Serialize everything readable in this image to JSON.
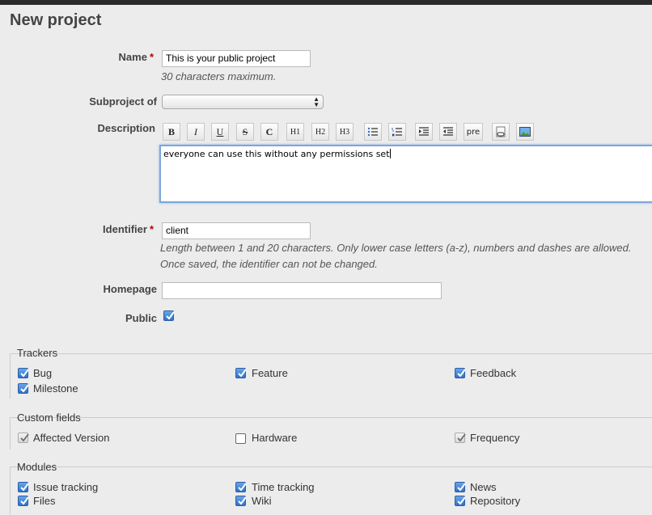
{
  "page": {
    "title": "New project"
  },
  "form": {
    "name": {
      "label": "Name",
      "required_mark": "*",
      "value": "This is your public project",
      "hint": "30 characters maximum."
    },
    "subproject": {
      "label": "Subproject of",
      "value": ""
    },
    "description": {
      "label": "Description",
      "toolbar": [
        "B",
        "I",
        "U",
        "S",
        "C",
        "H1",
        "H2",
        "H3",
        "ul",
        "ol",
        "indent",
        "outdent",
        "pre",
        "link",
        "image"
      ],
      "pre_label": "pre",
      "value": "everyone can use this without any permissions set"
    },
    "identifier": {
      "label": "Identifier",
      "required_mark": "*",
      "value": "client",
      "hint1": "Length between 1 and 20 characters. Only lower case letters (a-z), numbers and dashes are allowed.",
      "hint2": "Once saved, the identifier can not be changed."
    },
    "homepage": {
      "label": "Homepage",
      "value": ""
    },
    "public": {
      "label": "Public",
      "checked": true
    }
  },
  "trackers": {
    "legend": "Trackers",
    "items": [
      {
        "label": "Bug",
        "checked": true
      },
      {
        "label": "Feature",
        "checked": true
      },
      {
        "label": "Feedback",
        "checked": true
      },
      {
        "label": "Milestone",
        "checked": true
      }
    ]
  },
  "custom_fields": {
    "legend": "Custom fields",
    "items": [
      {
        "label": "Affected Version",
        "checked": true,
        "disabled": true
      },
      {
        "label": "Hardware",
        "checked": false,
        "disabled": false
      },
      {
        "label": "Frequency",
        "checked": true,
        "disabled": true
      }
    ]
  },
  "modules": {
    "legend": "Modules",
    "items": [
      {
        "label": "Issue tracking",
        "checked": true
      },
      {
        "label": "Time tracking",
        "checked": true
      },
      {
        "label": "News",
        "checked": true
      },
      {
        "label": "Files",
        "checked": true
      },
      {
        "label": "Wiki",
        "checked": true
      },
      {
        "label": "Repository",
        "checked": true
      }
    ]
  },
  "colors": {
    "accent_blue": "#2f72c9",
    "required": "#bb0000",
    "focus_border": "#7fa6d9"
  }
}
